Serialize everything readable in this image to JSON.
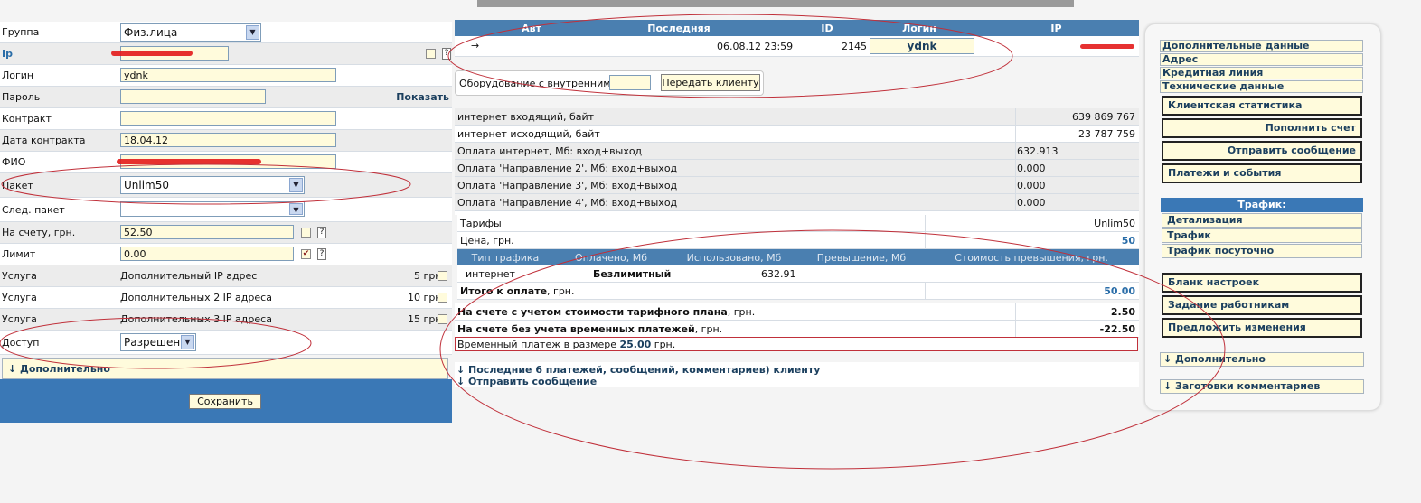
{
  "form": {
    "group": {
      "label": "Группа",
      "value": "Физ.лица"
    },
    "ip": {
      "label": "Ip"
    },
    "login": {
      "label": "Логин",
      "value": "ydnk"
    },
    "password": {
      "label": "Пароль",
      "show_label": "Показать"
    },
    "contract": {
      "label": "Контракт"
    },
    "contract_date": {
      "label": "Дата контракта",
      "value": "18.04.12"
    },
    "fio": {
      "label": "ФИО"
    },
    "package": {
      "label": "Пакет",
      "value": "Unlim50"
    },
    "next_package": {
      "label": "След. пакет"
    },
    "balance": {
      "label": "На счету, грн.",
      "value": "52.50"
    },
    "limit": {
      "label": "Лимит",
      "value": "0.00"
    },
    "services": [
      {
        "label": "Услуга",
        "name": "Дополнительный IP адрес",
        "price": "5 грн."
      },
      {
        "label": "Услуга",
        "name": "Дополнительных 2 IP адреса",
        "price": "10 грн."
      },
      {
        "label": "Услуга",
        "name": "Дополнительных 3 IP адреса",
        "price": "15 грн."
      }
    ],
    "access": {
      "label": "Доступ",
      "value": "Разрешен"
    },
    "extra": "↓ Дополнительно",
    "save": "Сохранить"
  },
  "sessions": {
    "headers": [
      "Авт",
      "Последняя",
      "ID",
      "Логин",
      "IP"
    ],
    "row": {
      "arrow": "→",
      "last": "06.08.12 23:59",
      "id": "2145",
      "login": "ydnk"
    }
  },
  "equipment": {
    "label": "Оборудование с внутренним №",
    "button": "Передать клиенту"
  },
  "stats": [
    {
      "label": "интернет входящий, байт",
      "value": "639 869 767",
      "align": "right"
    },
    {
      "label": "интернет исходящий, байт",
      "value": "23 787 759",
      "align": "right"
    },
    {
      "label": "Оплата интернет, Мб: вход+выход",
      "value": "632.913",
      "align": "left"
    },
    {
      "label": "Оплата 'Направление 2', Мб: вход+выход",
      "value": "0.000",
      "align": "left"
    },
    {
      "label": "Оплата 'Направление 3', Мб: вход+выход",
      "value": "0.000",
      "align": "left"
    },
    {
      "label": "Оплата 'Направление 4', Мб: вход+выход",
      "value": "0.000",
      "align": "left"
    }
  ],
  "tariff": {
    "tariffs_label": "Тарифы",
    "tariffs_value": "Unlim50",
    "price_label": "Цена, грн.",
    "price_value": "50",
    "headers": [
      "Тип трафика",
      "Оплачено, Мб",
      "Использовано, Мб",
      "Превышение, Мб",
      "Стоимость превышения, грн."
    ],
    "row": {
      "type": "интернет",
      "paid": "Безлимитный",
      "used": "632.91"
    },
    "total_label": "Итого к оплате",
    "total_unit": ", грн.",
    "total_value": "50.00"
  },
  "balance_rows": [
    {
      "label": "На счете с учетом стоимости тарифного плана",
      "unit": ", грн.",
      "value": "2.50"
    },
    {
      "label": "На счете без учета временных платежей",
      "unit": ", грн.",
      "value": "-22.50"
    }
  ],
  "temp_payment": {
    "prefix": "Временный платеж в размере",
    "amount": "25.00",
    "suffix": "грн."
  },
  "bottom_links": [
    "↓ Последние 6 платежей, сообщений, комментариев) клиенту",
    "↓ Отправить сообщение"
  ],
  "sidebar": {
    "links": [
      "Дополнительные данные",
      "Адрес",
      "Кредитная линия",
      "Технические данные"
    ],
    "buttons1": [
      "Клиентская статистика",
      "Пополнить счет",
      "Отправить сообщение",
      "Платежи и события"
    ],
    "traffic_header": "Трафик:",
    "traffic_links": [
      "Детализация",
      "Трафик",
      "Трафик посуточно"
    ],
    "buttons2": [
      "Бланк настроек",
      "Задание работникам",
      "Предложить изменения"
    ],
    "extra": "↓ Дополнительно",
    "comments": "↓ Заготовки комментариев"
  },
  "colors": {
    "accent": "#3a78b6",
    "field_bg": "#fffbdc",
    "annotation": "#c0303a"
  }
}
